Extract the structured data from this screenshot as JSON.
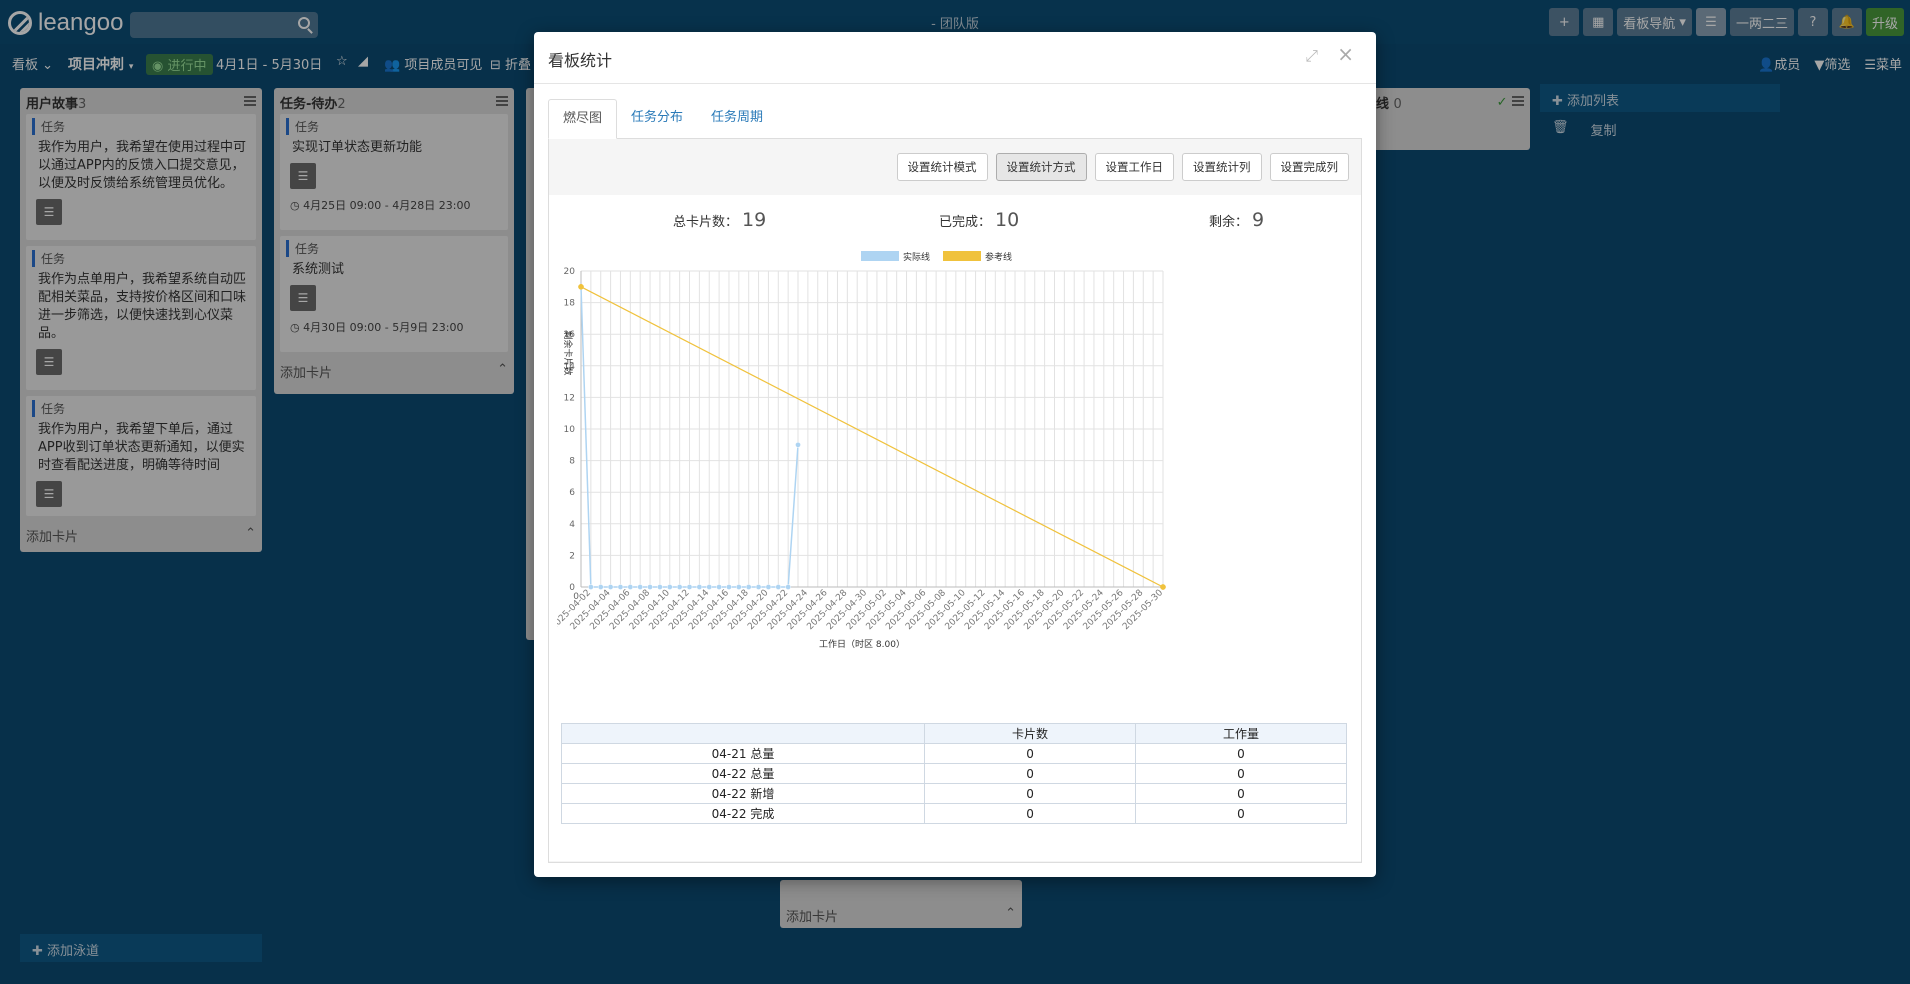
{
  "app": {
    "logo": "leangoo",
    "edition": "- 团队版"
  },
  "topbar": {
    "buttons": [
      "+",
      "看板导航",
      "一两二三",
      "?",
      "升级"
    ]
  },
  "subbar": {
    "board_menu": "看板",
    "project": "项目冲刺",
    "status": "进行中",
    "date_range": "4月1日 - 5月30日",
    "visibility": "项目成员可见",
    "collapse": "折叠",
    "right": [
      "成员",
      "筛选",
      "菜单"
    ]
  },
  "columns": [
    {
      "title": "用户故事",
      "count": "3",
      "cards": [
        {
          "tag": "任务",
          "text": "我作为用户，我希望在使用过程中可以通过APP内的反馈入口提交意见，以便及时反馈给系统管理员优化。"
        },
        {
          "tag": "任务",
          "text": "我作为点单用户，我希望系统自动匹配相关菜品，支持按价格区间和口味进一步筛选，以便快速找到心仪菜品。"
        },
        {
          "tag": "任务",
          "text": "我作为用户，我希望下单后，通过APP收到订单状态更新通知，以便实时查看配送进度，明确等待时间"
        }
      ],
      "footer": "添加卡片"
    },
    {
      "title": "任务-待办",
      "count": "2",
      "cards": [
        {
          "tag": "任务",
          "text": "实现订单状态更新功能",
          "date": "4月25日 09:00 - 4月28日 23:00"
        },
        {
          "tag": "任务",
          "text": "系统测试",
          "date": "4月30日 09:00 - 5月9日 23:00"
        }
      ],
      "footer": "添加卡片"
    }
  ],
  "right_col": {
    "title": "线",
    "count": "0"
  },
  "add_list": "添加列表",
  "list_actions": [
    "复制"
  ],
  "bottom_col_footer": "添加卡片",
  "add_lane": "添加泳道",
  "modal": {
    "title": "看板统计",
    "tabs": [
      {
        "label": "燃尽图",
        "active": true
      },
      {
        "label": "任务分布",
        "active": false
      },
      {
        "label": "任务周期",
        "active": false
      }
    ],
    "buttons": [
      "设置统计模式",
      "设置统计方式",
      "设置工作日",
      "设置统计列",
      "设置完成列"
    ],
    "stats": {
      "total_label": "总卡片数：",
      "total": "19",
      "done_label": "已完成：",
      "done": "10",
      "remain_label": "剩余：",
      "remain": "9"
    },
    "table": {
      "headers": [
        "",
        "卡片数",
        "工作量"
      ],
      "rows": [
        [
          "04-21 总量",
          "0",
          "0"
        ],
        [
          "04-22 总量",
          "0",
          "0"
        ],
        [
          "04-22 新增",
          "0",
          "0"
        ],
        [
          "04-22 完成",
          "0",
          "0"
        ]
      ]
    }
  },
  "chart_data": {
    "type": "line",
    "ylabel": "剩余卡片数",
    "xlabel": "工作日（时区 8.00）",
    "ylim": [
      0,
      20
    ],
    "yticks": [
      0,
      2,
      4,
      6,
      8,
      10,
      12,
      14,
      16,
      18,
      20
    ],
    "x_start_label": "0",
    "x_tick_labels": [
      "2025-04-02",
      "2025-04-04",
      "2025-04-06",
      "2025-04-08",
      "2025-04-10",
      "2025-04-12",
      "2025-04-14",
      "2025-04-16",
      "2025-04-18",
      "2025-04-20",
      "2025-04-22",
      "2025-04-24",
      "2025-04-26",
      "2025-04-28",
      "2025-04-30",
      "2025-05-02",
      "2025-05-04",
      "2025-05-06",
      "2025-05-08",
      "2025-05-10",
      "2025-05-12",
      "2025-05-14",
      "2025-05-16",
      "2025-05-18",
      "2025-05-20",
      "2025-05-22",
      "2025-05-24",
      "2025-05-26",
      "2025-05-28",
      "2025-05-30"
    ],
    "legend_position": "top",
    "grid": true,
    "series": [
      {
        "name": "实际线",
        "color": "#aed4f2",
        "x": [
          "2025-04-01",
          "2025-04-02",
          "2025-04-03",
          "2025-04-04",
          "2025-04-05",
          "2025-04-06",
          "2025-04-07",
          "2025-04-08",
          "2025-04-09",
          "2025-04-10",
          "2025-04-11",
          "2025-04-12",
          "2025-04-13",
          "2025-04-14",
          "2025-04-15",
          "2025-04-16",
          "2025-04-17",
          "2025-04-18",
          "2025-04-19",
          "2025-04-20",
          "2025-04-21",
          "2025-04-22",
          "2025-04-23"
        ],
        "values": [
          19,
          0,
          0,
          0,
          0,
          0,
          0,
          0,
          0,
          0,
          0,
          0,
          0,
          0,
          0,
          0,
          0,
          0,
          0,
          0,
          0,
          0,
          9
        ]
      },
      {
        "name": "参考线",
        "color": "#f0c23c",
        "x": [
          "2025-04-01",
          "2025-05-30"
        ],
        "values": [
          19,
          0
        ]
      }
    ]
  }
}
